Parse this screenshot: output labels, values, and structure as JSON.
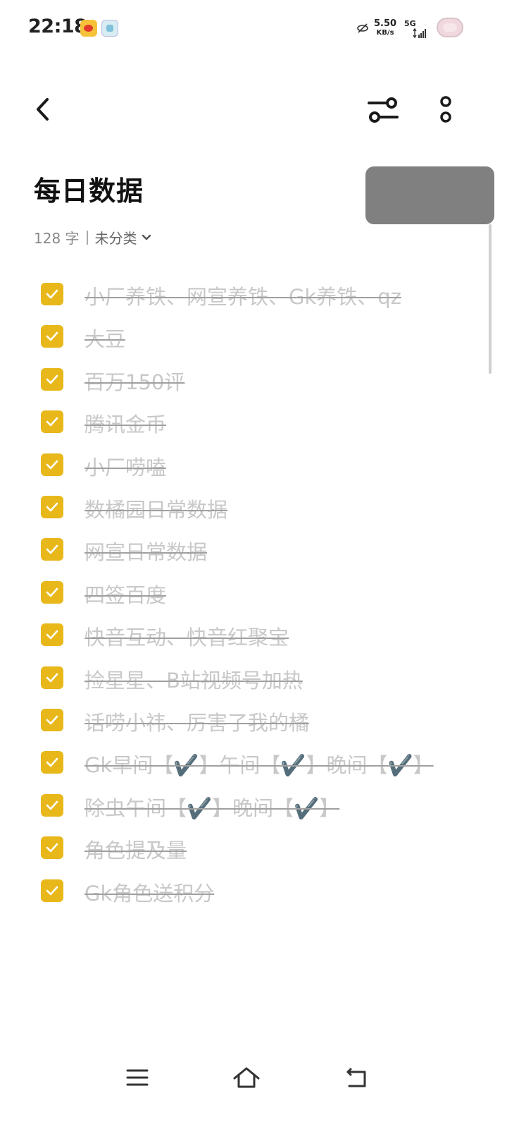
{
  "status_bar": {
    "time": "22:18",
    "net_speed_value": "5.50",
    "net_speed_unit": "KB/s",
    "network_type": "5G",
    "icons": [
      "weibo-icon",
      "app-icon",
      "no-sync-icon",
      "signal-icon",
      "battery-icon"
    ]
  },
  "toolbar": {
    "back_icon": "chevron-left-icon",
    "filter_icon": "sliders-icon",
    "more_icon": "more-vertical-icon"
  },
  "note": {
    "title": "每日数据",
    "word_count": "128 字",
    "category": "未分类"
  },
  "checklist": {
    "accent_color": "#e8b81b",
    "items": [
      {
        "text": "小厂养铁、网宣养铁、Gk养铁、qz",
        "checked": true
      },
      {
        "text": "大豆",
        "checked": true
      },
      {
        "text": "百万150评",
        "checked": true
      },
      {
        "text": "腾讯金币",
        "checked": true
      },
      {
        "text": "小厂唠嗑",
        "checked": true
      },
      {
        "text": "数橘园日常数据",
        "checked": true
      },
      {
        "text": "网宣日常数据",
        "checked": true
      },
      {
        "text": "四签百度",
        "checked": true
      },
      {
        "text": "快音互动、快音红聚宝",
        "checked": true
      },
      {
        "text": "捡星星、B站视频号加热",
        "checked": true
      },
      {
        "text": "话唠小祎、厉害了我的橘",
        "checked": true
      },
      {
        "text": "Gk早间【✔️】午间【✔️】晚间【✔️】",
        "checked": true
      },
      {
        "text": "除虫午间【✔️】晚间【✔️】",
        "checked": true
      },
      {
        "text": "角色提及量",
        "checked": true
      },
      {
        "text": "Gk角色送积分",
        "checked": true
      }
    ]
  },
  "nav_bar": {
    "icons": [
      "menu-icon",
      "home-icon",
      "back-icon"
    ]
  }
}
